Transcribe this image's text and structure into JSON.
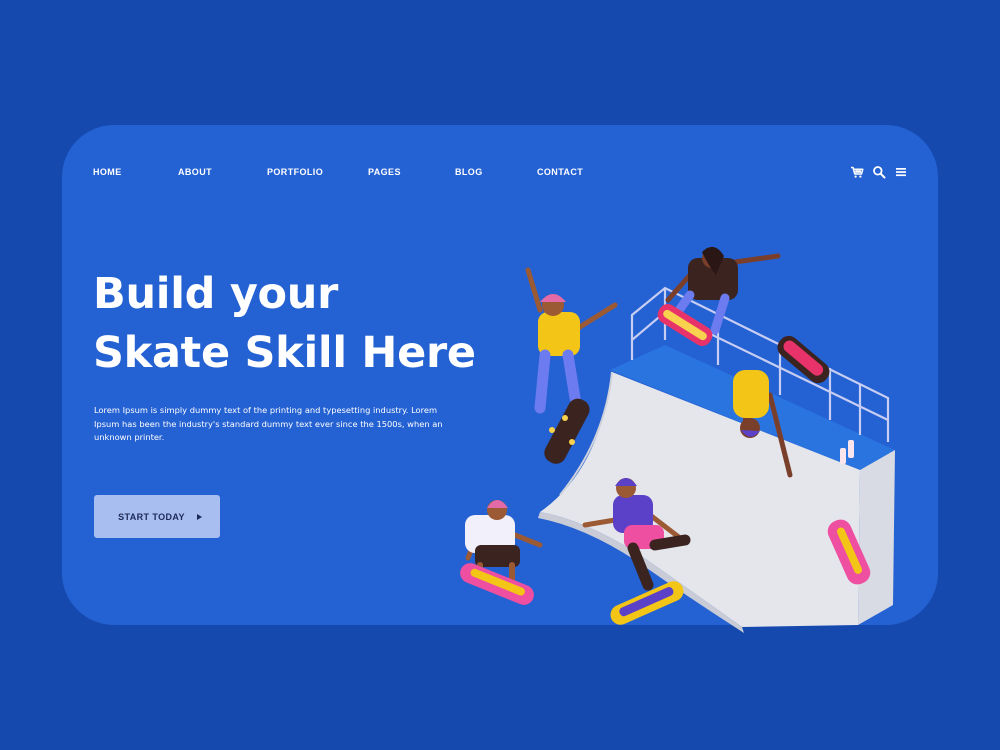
{
  "nav": {
    "items": [
      {
        "label": "HOME"
      },
      {
        "label": "ABOUT"
      },
      {
        "label": "PORTFOLIO"
      },
      {
        "label": "PAGES"
      },
      {
        "label": "BLOG"
      },
      {
        "label": "CONTACT"
      }
    ],
    "icons": [
      "cart-icon",
      "search-icon",
      "menu-icon"
    ]
  },
  "hero": {
    "title_line1": "Build your",
    "title_line2": "Skate Skill Here",
    "description": "Lorem Ipsum is simply dummy text of the printing and typesetting industry. Lorem Ipsum has been the industry's standard dummy text ever since the 1500s, when an unknown printer.",
    "cta_label": "START TODAY"
  },
  "colors": {
    "page_background": "#1549ae",
    "card_background": "#2461d2",
    "cta_background": "#a8bdf0",
    "text": "#ffffff"
  }
}
